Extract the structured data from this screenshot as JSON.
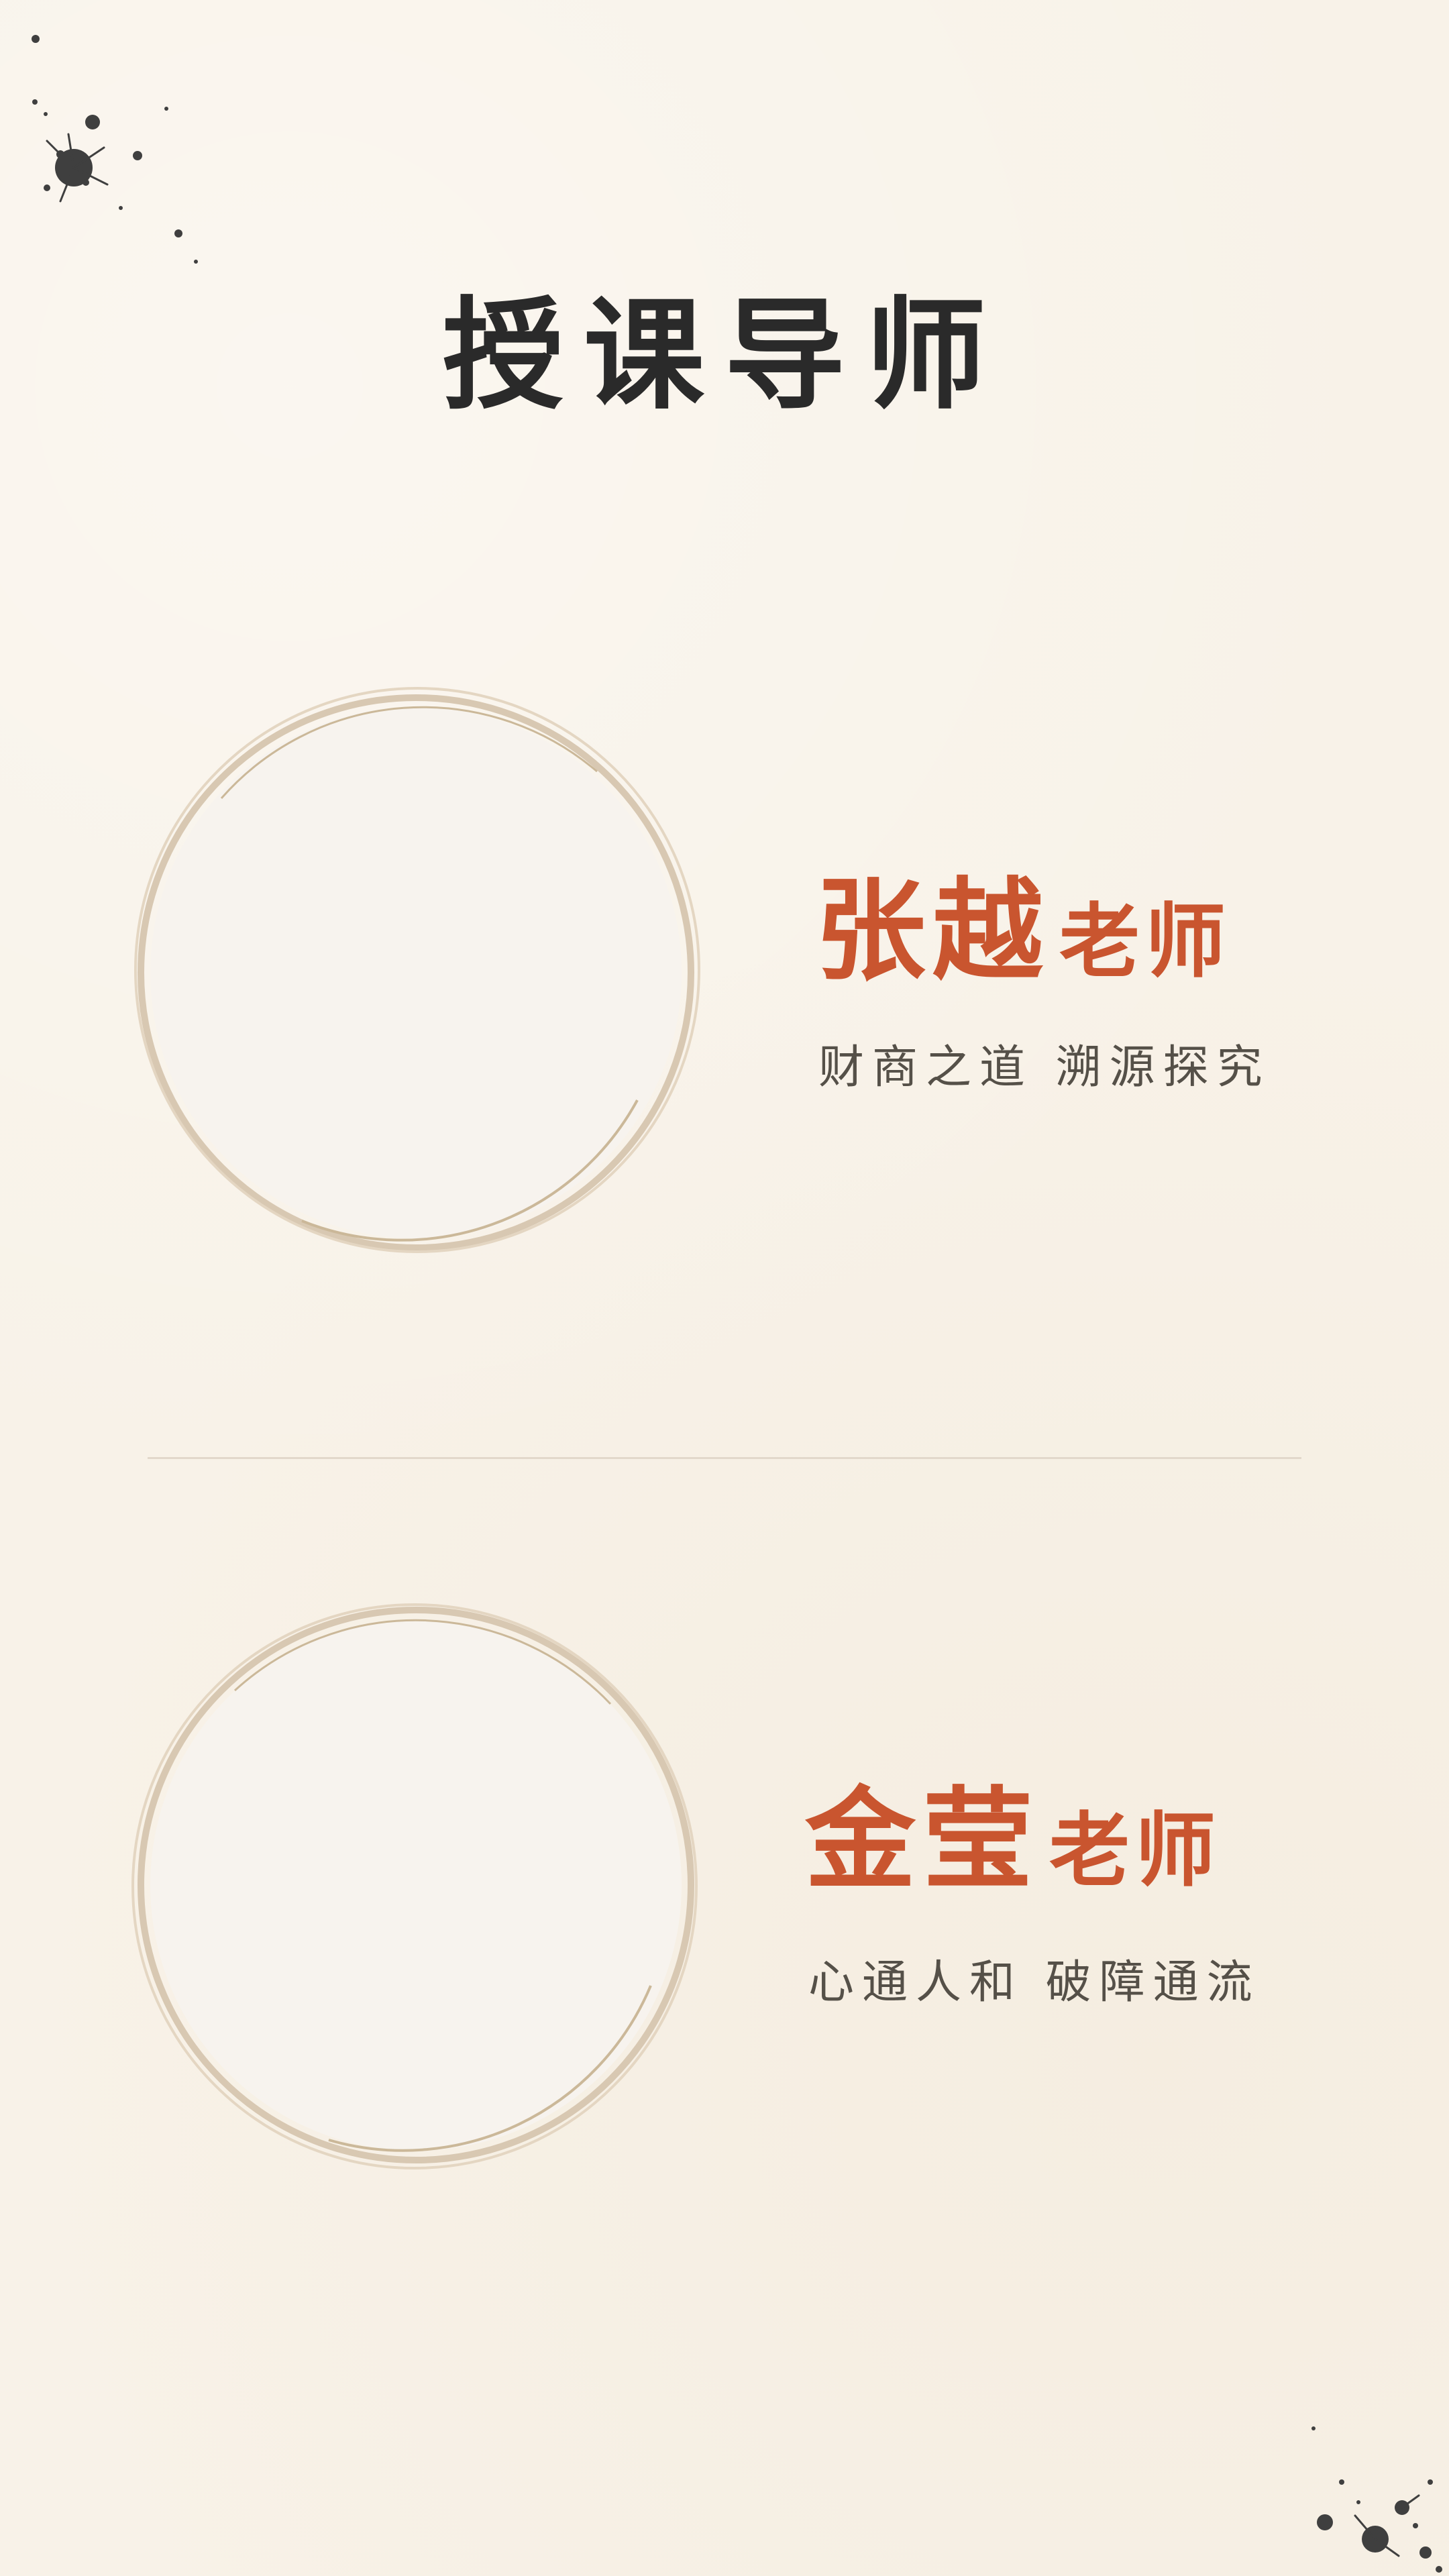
{
  "title": "授课导师",
  "colors": {
    "background": "#f8f2e8",
    "accent": "#c9552f",
    "title": "#2a2a2a",
    "motto": "#555048",
    "frame": "#d8c8b2",
    "portrait_fill": "#f7f3ee"
  },
  "teachers": [
    {
      "surname": "张越",
      "honorific": "老师",
      "motto": "财商之道 溯源探究"
    },
    {
      "surname": "金莹",
      "honorific": "老师",
      "motto": "心通人和 破障通流"
    }
  ]
}
